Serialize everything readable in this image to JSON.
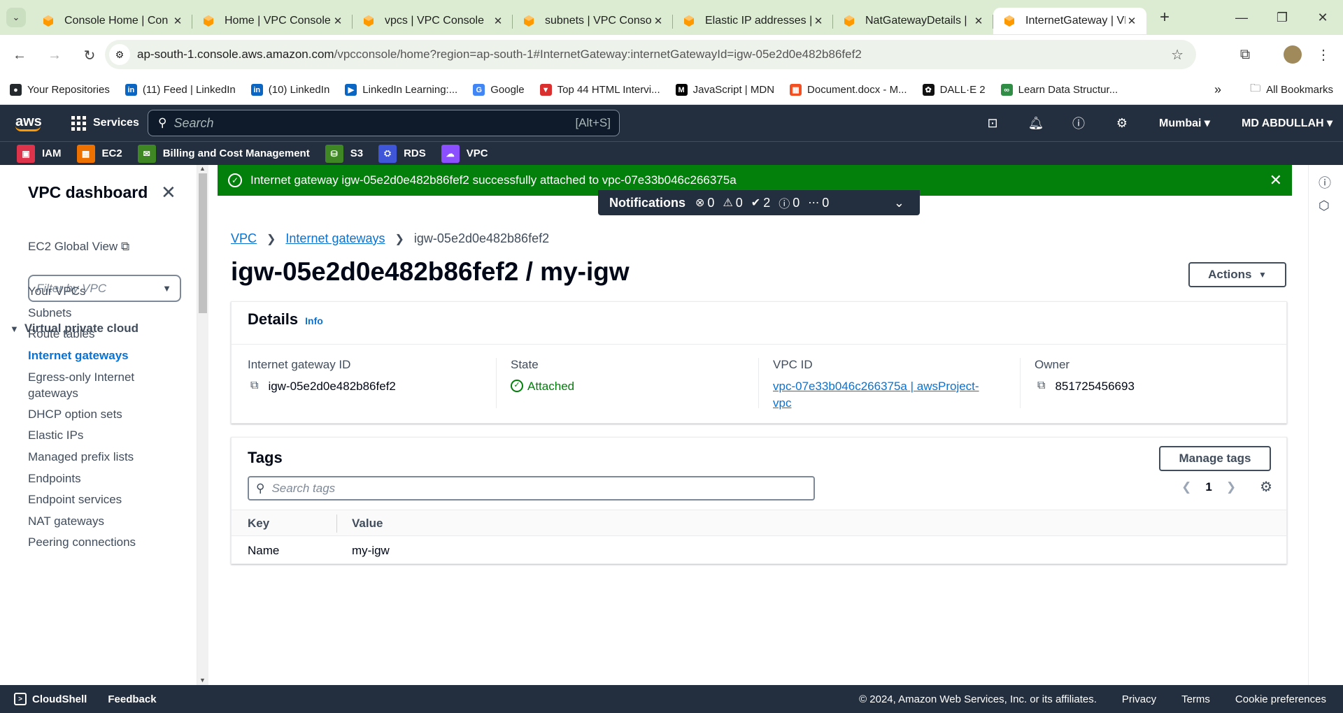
{
  "browser": {
    "tabs": [
      {
        "label": "Console Home | Con"
      },
      {
        "label": "Home | VPC Console"
      },
      {
        "label": "vpcs | VPC Console"
      },
      {
        "label": "subnets | VPC Conso"
      },
      {
        "label": "Elastic IP addresses |"
      },
      {
        "label": "NatGatewayDetails |"
      },
      {
        "label": "InternetGateway | VP"
      }
    ],
    "url_host": "ap-south-1.console.aws.amazon.com",
    "url_rest": "/vpcconsole/home?region=ap-south-1#InternetGateway:internetGatewayId=igw-05e2d0e482b86fef2",
    "bookmarks": [
      {
        "label": "Your Repositories",
        "color": "#24292e",
        "glyph": "●"
      },
      {
        "label": "(11) Feed | LinkedIn",
        "color": "#0a66c2",
        "glyph": "in"
      },
      {
        "label": "(10) LinkedIn",
        "color": "#0a66c2",
        "glyph": "in"
      },
      {
        "label": "LinkedIn Learning:...",
        "color": "#0a66c2",
        "glyph": "▶"
      },
      {
        "label": "Google",
        "color": "#4285f4",
        "glyph": "G"
      },
      {
        "label": "Top 44 HTML Intervi...",
        "color": "#d92f2f",
        "glyph": "▼"
      },
      {
        "label": "JavaScript | MDN",
        "color": "#000000",
        "glyph": "M"
      },
      {
        "label": "Document.docx - M...",
        "color": "#f25022",
        "glyph": "▦"
      },
      {
        "label": "DALL·E 2",
        "color": "#111111",
        "glyph": "✿"
      },
      {
        "label": "Learn Data Structur...",
        "color": "#2f8d46",
        "glyph": "∞"
      }
    ],
    "all_bookmarks": "All Bookmarks"
  },
  "aws": {
    "logo": "aws",
    "services": "Services",
    "search_placeholder": "Search",
    "search_shortcut": "[Alt+S]",
    "region": "Mumbai",
    "user": "MD ABDULLAH",
    "favorites": [
      {
        "label": "IAM",
        "color": "#dd344c"
      },
      {
        "label": "EC2",
        "color": "#ed7100"
      },
      {
        "label": "Billing and Cost Management",
        "color": "#3f8624"
      },
      {
        "label": "S3",
        "color": "#3f8624"
      },
      {
        "label": "RDS",
        "color": "#4056d8"
      },
      {
        "label": "VPC",
        "color": "#8c4fff"
      }
    ]
  },
  "sidenav": {
    "title": "VPC dashboard",
    "ec2_global": "EC2 Global View",
    "filter_placeholder": "Filter by VPC",
    "section": "Virtual private cloud",
    "items": [
      {
        "label": "Your VPCs"
      },
      {
        "label": "Subnets"
      },
      {
        "label": "Route tables"
      },
      {
        "label": "Internet gateways"
      },
      {
        "label": "Egress-only Internet gateways"
      },
      {
        "label": "DHCP option sets"
      },
      {
        "label": "Elastic IPs"
      },
      {
        "label": "Managed prefix lists"
      },
      {
        "label": "Endpoints"
      },
      {
        "label": "Endpoint services"
      },
      {
        "label": "NAT gateways"
      },
      {
        "label": "Peering connections"
      }
    ]
  },
  "flash": {
    "message": "Internet gateway igw-05e2d0e482b86fef2 successfully attached to vpc-07e33b046c266375a"
  },
  "notifications": {
    "title": "Notifications",
    "error": "0",
    "warning": "0",
    "success": "2",
    "info": "0",
    "in_progress": "0"
  },
  "breadcrumb": {
    "vpc": "VPC",
    "igws": "Internet gateways",
    "current": "igw-05e2d0e482b86fef2"
  },
  "page": {
    "title": "igw-05e2d0e482b86fef2 / my-igw",
    "actions": "Actions"
  },
  "details": {
    "heading": "Details",
    "info": "Info",
    "igw_id_label": "Internet gateway ID",
    "igw_id": "igw-05e2d0e482b86fef2",
    "state_label": "State",
    "state": "Attached",
    "vpc_label": "VPC ID",
    "vpc_value": "vpc-07e33b046c266375a | awsProject-vpc",
    "owner_label": "Owner",
    "owner": "851725456693"
  },
  "tags": {
    "heading": "Tags",
    "manage": "Manage tags",
    "search_placeholder": "Search tags",
    "page": "1",
    "col_key": "Key",
    "col_value": "Value",
    "rows": [
      {
        "key": "Name",
        "value": "my-igw"
      }
    ]
  },
  "footer": {
    "cloudshell": "CloudShell",
    "feedback": "Feedback",
    "copyright": "© 2024, Amazon Web Services, Inc. or its affiliates.",
    "privacy": "Privacy",
    "terms": "Terms",
    "cookies": "Cookie preferences"
  },
  "colors": {
    "aws_nav": "#232f3e",
    "success": "#037f0c",
    "link": "#0972d3",
    "chrome_tabbar": "#dbecd2",
    "aws_orange": "#ff9900"
  }
}
